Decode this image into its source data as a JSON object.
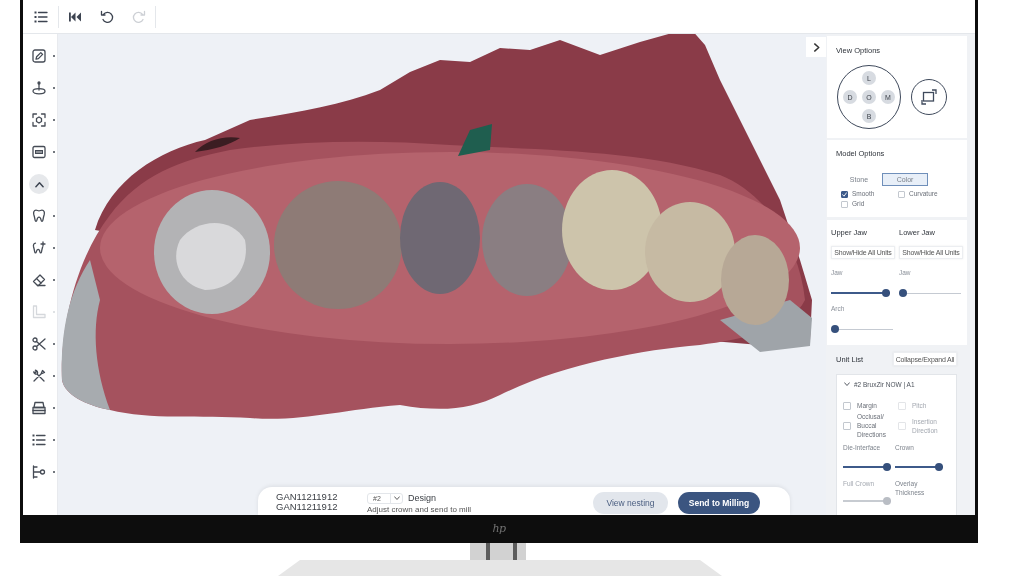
{
  "toolbar": {
    "buttons": [
      {
        "kind": "menu",
        "disabled": false
      },
      {
        "kind": "first",
        "disabled": false
      },
      {
        "kind": "undo",
        "disabled": false
      },
      {
        "kind": "redo",
        "disabled": true
      }
    ]
  },
  "sidebar": {
    "tools": [
      {
        "kind": "tool",
        "disabled": false
      },
      {
        "kind": "tool",
        "disabled": false
      },
      {
        "kind": "tool",
        "disabled": false
      },
      {
        "kind": "tool",
        "disabled": false
      },
      {
        "kind": "collapse",
        "disabled": false
      },
      {
        "kind": "tool",
        "disabled": false
      },
      {
        "kind": "tool",
        "disabled": false
      },
      {
        "kind": "tool",
        "disabled": false
      },
      {
        "kind": "tool",
        "disabled": true
      },
      {
        "kind": "tool",
        "disabled": false
      },
      {
        "kind": "tool",
        "disabled": false
      },
      {
        "kind": "tool",
        "disabled": false
      },
      {
        "kind": "tool",
        "disabled": false
      },
      {
        "kind": "tool",
        "disabled": false
      }
    ]
  },
  "viewport": {
    "bottom_bar": {
      "case_ids": [
        "GAN11211912",
        "GAN11211912"
      ],
      "unit": "#2",
      "step": "Design",
      "hint": "Adjust crown and send to mill",
      "buttons": [
        {
          "label": "View nesting",
          "kind": "secondary"
        },
        {
          "label": "Send to Milling",
          "kind": "primary"
        }
      ]
    }
  },
  "right_panel": {
    "view_options": {
      "title": "View Options",
      "directions": [
        "L",
        "D",
        "O",
        "M",
        "B"
      ]
    },
    "model_options": {
      "title": "Model Options",
      "modes": [
        {
          "label": "Stone",
          "selected": false
        },
        {
          "label": "Color",
          "selected": true
        }
      ],
      "checkboxes": [
        {
          "label": "Smooth",
          "checked": true
        },
        {
          "label": "Curvature",
          "checked": false
        },
        {
          "label": "Grid",
          "checked": false
        }
      ]
    },
    "jaws": [
      {
        "title": "Upper Jaw",
        "button": "Show/Hide All Units",
        "sliders": [
          {
            "label": "Jaw",
            "level": 1
          },
          {
            "label": "Arch",
            "level": 0
          }
        ]
      },
      {
        "title": "Lower Jaw",
        "button": "Show/Hide All Units",
        "sliders": [
          {
            "label": "Jaw",
            "level": 0
          }
        ]
      }
    ],
    "unit_list": {
      "title": "Unit List",
      "button": "Collapse/Expand All",
      "units": [
        {
          "name": "#2 BruxZir NOW | A1",
          "expanded": true,
          "options": [
            {
              "label": "Margin",
              "checked": false,
              "disabled": false
            },
            {
              "label": "Pitch",
              "checked": false,
              "disabled": true
            },
            {
              "label": "Occlusal/ Buccal Directions",
              "checked": false,
              "disabled": false
            },
            {
              "label": "Insertion Direction",
              "checked": false,
              "disabled": true
            }
          ],
          "sliders": [
            {
              "label": "Die-Interface",
              "level": 1,
              "disabled": false
            },
            {
              "label": "Crown",
              "level": 1,
              "disabled": false
            },
            {
              "label": "Full Crown",
              "level": 1,
              "disabled": true
            },
            {
              "label": "Overlay Thickness",
              "disabled": false
            }
          ]
        }
      ]
    }
  },
  "monitor": {
    "logo": "hp"
  }
}
